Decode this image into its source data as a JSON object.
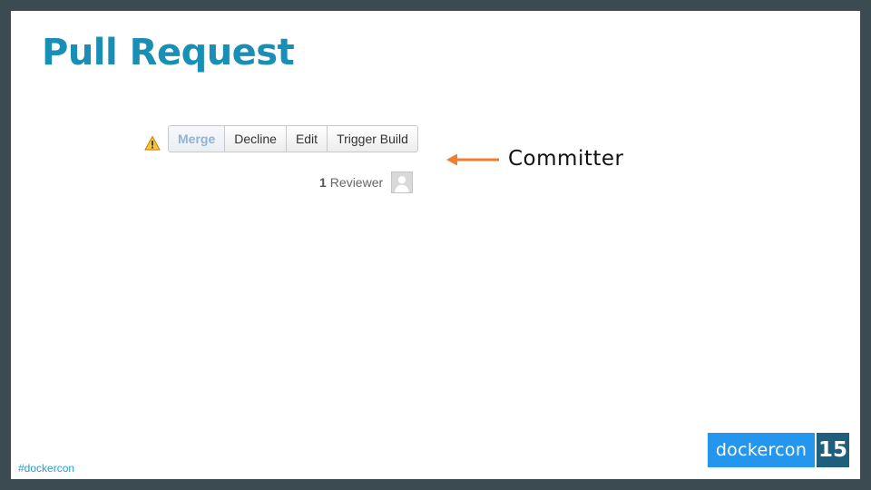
{
  "slide": {
    "title": "Pull Request",
    "hashtag": "#dockercon",
    "logo_text": "dockercon",
    "logo_year": "15"
  },
  "pr_toolbar": {
    "warning_icon": "warning-icon",
    "buttons": [
      {
        "label": "Merge"
      },
      {
        "label": "Decline"
      },
      {
        "label": "Edit"
      },
      {
        "label": "Trigger Build"
      }
    ],
    "reviewer_count": "1",
    "reviewer_label": "Reviewer",
    "avatar_icon": "avatar-placeholder-icon"
  },
  "annotation": {
    "label": "Committer",
    "arrow_icon": "arrow-left-icon"
  },
  "colors": {
    "title": "#1a8fb5",
    "arrow": "#f07f2d",
    "logo": "#2496ed",
    "frame": "#3c4a52",
    "warning": "#e8a317"
  }
}
